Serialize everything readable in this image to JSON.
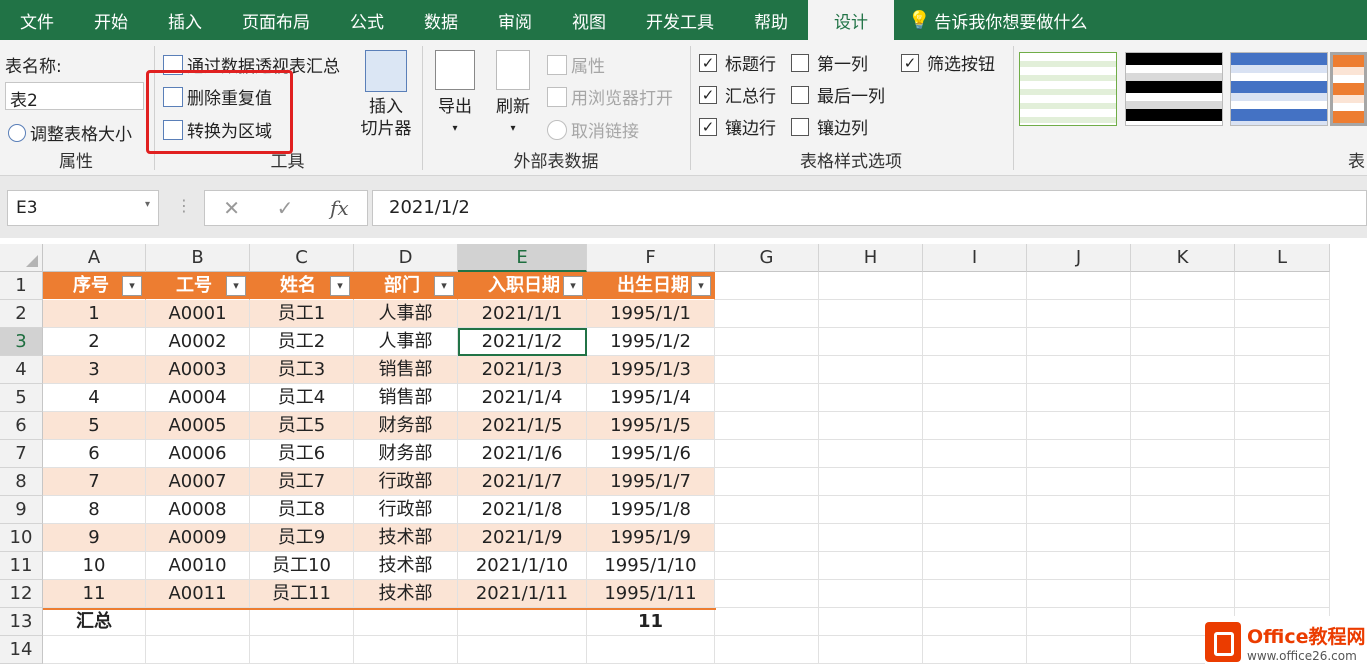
{
  "tabs": [
    "文件",
    "开始",
    "插入",
    "页面布局",
    "公式",
    "数据",
    "审阅",
    "视图",
    "开发工具",
    "帮助",
    "设计"
  ],
  "tell_me": "告诉我你想要做什么",
  "ribbon": {
    "properties": {
      "table_name_label": "表名称:",
      "table_name_value": "表2",
      "resize": "调整表格大小",
      "group": "属性"
    },
    "tools": {
      "pivot": "通过数据透视表汇总",
      "remove_dup": "删除重复值",
      "convert": "转换为区域",
      "slicer_l1": "插入",
      "slicer_l2": "切片器",
      "group": "工具"
    },
    "external": {
      "export": "导出",
      "refresh": "刷新",
      "props": "属性",
      "browser": "用浏览器打开",
      "unlink": "取消链接",
      "group": "外部表数据"
    },
    "style_options": {
      "header_row": "标题行",
      "total_row": "汇总行",
      "banded_rows": "镶边行",
      "first_col": "第一列",
      "last_col": "最后一列",
      "banded_cols": "镶边列",
      "filter_btn": "筛选按钮",
      "group": "表格样式选项"
    },
    "styles_group_partial": "表"
  },
  "formula_bar": {
    "name_box": "E3",
    "fx": "fx",
    "value": "2021/1/2"
  },
  "columns": [
    "A",
    "B",
    "C",
    "D",
    "E",
    "F",
    "G",
    "H",
    "I",
    "J",
    "K",
    "L"
  ],
  "rows": [
    "1",
    "2",
    "3",
    "4",
    "5",
    "6",
    "7",
    "8",
    "9",
    "10",
    "11",
    "12",
    "13",
    "14"
  ],
  "table": {
    "headers": [
      "序号",
      "工号",
      "姓名",
      "部门",
      "入职日期",
      "出生日期"
    ],
    "data": [
      [
        "1",
        "A0001",
        "员工1",
        "人事部",
        "2021/1/1",
        "1995/1/1"
      ],
      [
        "2",
        "A0002",
        "员工2",
        "人事部",
        "2021/1/2",
        "1995/1/2"
      ],
      [
        "3",
        "A0003",
        "员工3",
        "销售部",
        "2021/1/3",
        "1995/1/3"
      ],
      [
        "4",
        "A0004",
        "员工4",
        "销售部",
        "2021/1/4",
        "1995/1/4"
      ],
      [
        "5",
        "A0005",
        "员工5",
        "财务部",
        "2021/1/5",
        "1995/1/5"
      ],
      [
        "6",
        "A0006",
        "员工6",
        "财务部",
        "2021/1/6",
        "1995/1/6"
      ],
      [
        "7",
        "A0007",
        "员工7",
        "行政部",
        "2021/1/7",
        "1995/1/7"
      ],
      [
        "8",
        "A0008",
        "员工8",
        "行政部",
        "2021/1/8",
        "1995/1/8"
      ],
      [
        "9",
        "A0009",
        "员工9",
        "技术部",
        "2021/1/9",
        "1995/1/9"
      ],
      [
        "10",
        "A0010",
        "员工10",
        "技术部",
        "2021/1/10",
        "1995/1/10"
      ],
      [
        "11",
        "A0011",
        "员工11",
        "技术部",
        "2021/1/11",
        "1995/1/11"
      ]
    ],
    "total_label": "汇总",
    "total_value": "11"
  },
  "watermark": {
    "brand": "Office教程网",
    "url": "www.office26.com"
  }
}
